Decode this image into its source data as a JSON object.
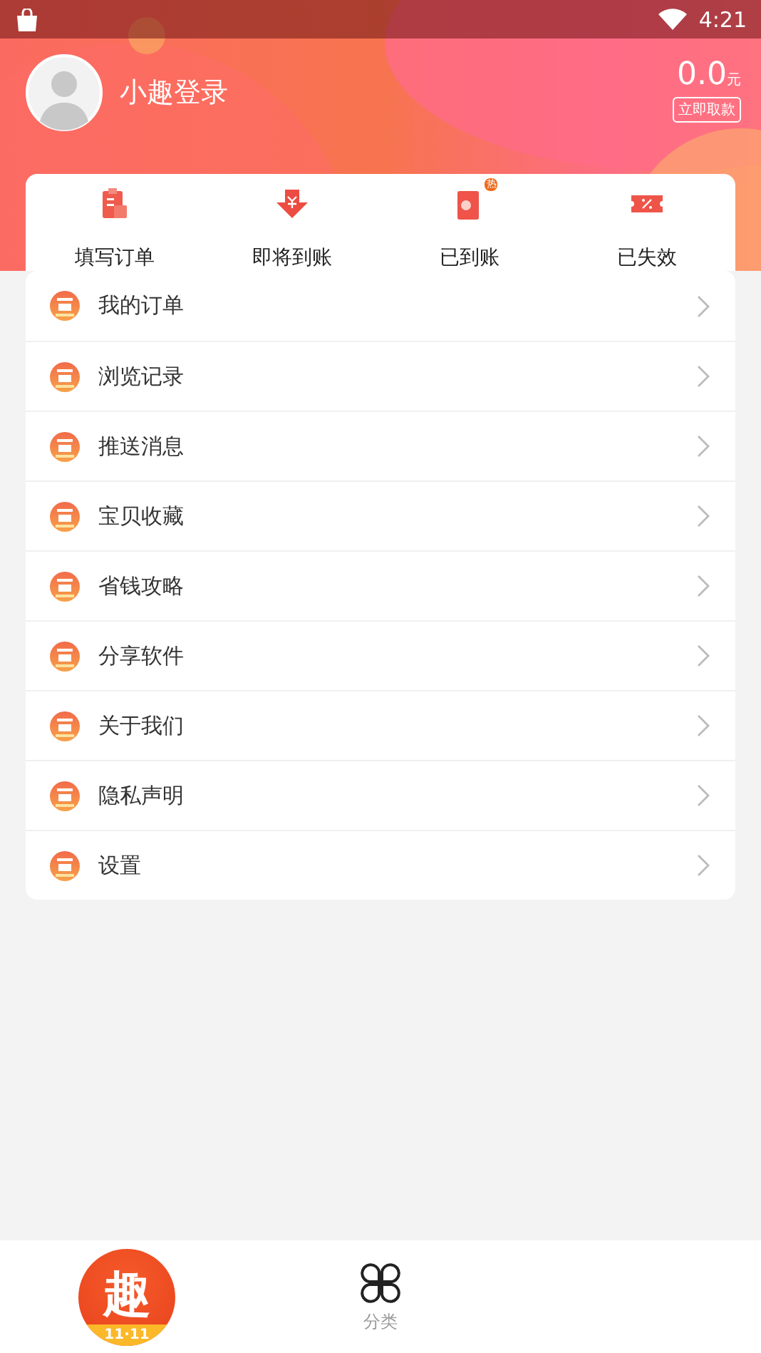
{
  "status_bar": {
    "time": "4:21"
  },
  "profile": {
    "name": "小趣登录",
    "balance": "0.0",
    "unit": "元",
    "withdraw": "立即取款"
  },
  "order_tabs": [
    {
      "label": "填写订单",
      "kind": "clipboard"
    },
    {
      "label": "即将到账",
      "kind": "arrival"
    },
    {
      "label": "已到账",
      "kind": "received",
      "badge": "热"
    },
    {
      "label": "已失效",
      "kind": "coupon"
    }
  ],
  "menu": [
    {
      "label": "我的订单"
    },
    {
      "label": "浏览记录"
    },
    {
      "label": "推送消息"
    },
    {
      "label": "宝贝收藏"
    },
    {
      "label": "省钱攻略"
    },
    {
      "label": "分享软件"
    },
    {
      "label": "关于我们"
    },
    {
      "label": "隐私声明"
    },
    {
      "label": "设置"
    }
  ],
  "bottom_nav": [
    {
      "kind": "logo",
      "glyph": "趣",
      "caption": "11·11",
      "selected": true
    },
    {
      "kind": "tab",
      "label": "分类",
      "selected": false
    }
  ]
}
